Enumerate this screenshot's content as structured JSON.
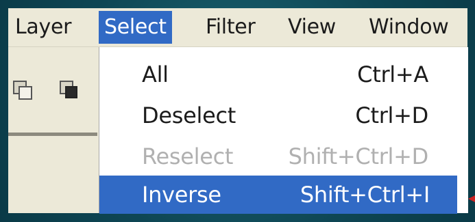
{
  "menubar": {
    "items": [
      {
        "label": "Layer"
      },
      {
        "label": "Select"
      },
      {
        "label": "Filter"
      },
      {
        "label": "View"
      },
      {
        "label": "Window"
      }
    ]
  },
  "toolstrip": {
    "icons": [
      "intersect-selection-icon",
      "subtract-selection-icon"
    ]
  },
  "select_menu": {
    "items": [
      {
        "label": "All",
        "shortcut": "Ctrl+A",
        "state": "enabled"
      },
      {
        "label": "Deselect",
        "shortcut": "Ctrl+D",
        "state": "enabled"
      },
      {
        "label": "Reselect",
        "shortcut": "Shift+Ctrl+D",
        "state": "disabled"
      },
      {
        "label": "Inverse",
        "shortcut": "Shift+Ctrl+I",
        "state": "highlighted"
      }
    ]
  },
  "colors": {
    "menu_bg": "#ece9d8",
    "highlight": "#316ac5",
    "disabled_text": "#b0b0b0",
    "dropdown_bg": "#ffffff",
    "frame": "#0f4a5a"
  }
}
